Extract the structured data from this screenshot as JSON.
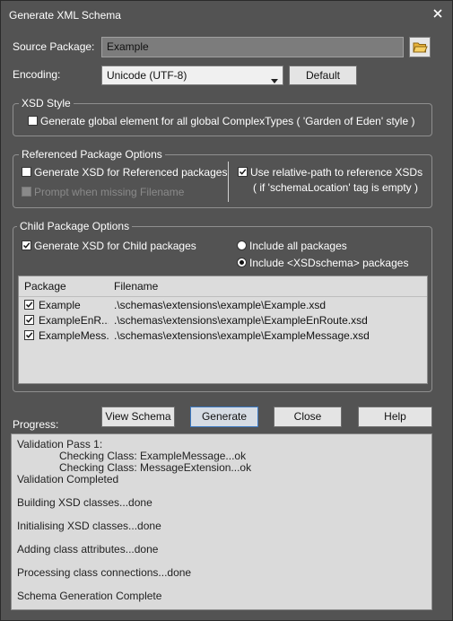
{
  "window": {
    "title": "Generate XML Schema"
  },
  "source": {
    "label": "Source Package:",
    "value": "Example"
  },
  "encoding": {
    "label": "Encoding:",
    "value": "Unicode (UTF-8)",
    "default_button": "Default"
  },
  "xsd_style": {
    "title": "XSD Style",
    "garden_of_eden": {
      "label": "Generate global element for all global ComplexTypes ( 'Garden of Eden' style )",
      "checked": false
    }
  },
  "ref_options": {
    "title": "Referenced Package Options",
    "generate_ref": {
      "label": "Generate XSD for Referenced packages",
      "checked": false
    },
    "prompt_missing": {
      "label": "Prompt when missing Filename",
      "checked": false,
      "enabled": false
    },
    "relative_path": {
      "label": "Use relative-path to reference XSDs",
      "checked": true
    },
    "relative_path_note": "( if 'schemaLocation' tag is empty )"
  },
  "child_options": {
    "title": "Child Package Options",
    "generate_child": {
      "label": "Generate XSD for Child packages",
      "checked": true
    },
    "include_all": {
      "label": "Include all packages",
      "selected": false
    },
    "include_xsdschema": {
      "label": "Include <XSDschema> packages",
      "selected": true
    },
    "columns": {
      "package": "Package",
      "filename": "Filename"
    },
    "rows": [
      {
        "package": "Example",
        "filename": ".\\schemas\\extensions\\example\\Example.xsd",
        "checked": true
      },
      {
        "package": "ExampleEnR...",
        "filename": ".\\schemas\\extensions\\example\\ExampleEnRoute.xsd",
        "checked": true
      },
      {
        "package": "ExampleMess...",
        "filename": ".\\schemas\\extensions\\example\\ExampleMessage.xsd",
        "checked": true
      }
    ]
  },
  "buttons": {
    "view_schema": "View Schema",
    "generate": "Generate",
    "close": "Close",
    "help": "Help"
  },
  "progress": {
    "label": "Progress:",
    "lines": [
      "Validation Pass 1:",
      "Checking Class: ExampleMessage...ok",
      "Checking Class: MessageExtension...ok",
      "Validation Completed",
      "Building XSD classes...done",
      "Initialising XSD classes...done",
      "Adding class attributes...done",
      "Processing class connections...done",
      "Schema Generation Complete"
    ]
  }
}
